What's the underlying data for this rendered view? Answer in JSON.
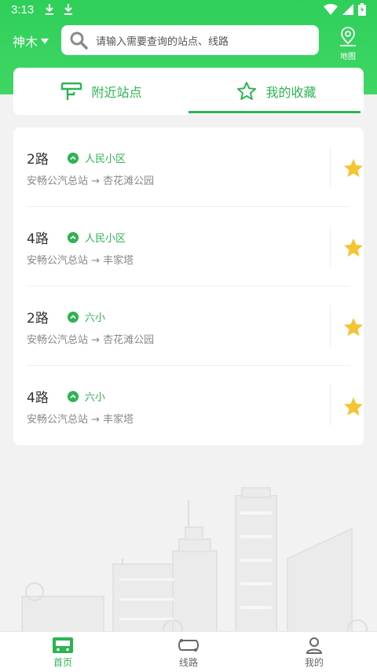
{
  "status_bar": {
    "time": "3:13"
  },
  "header": {
    "city": "神木",
    "search_placeholder": "请输入需要查询的站点、线路",
    "map_label": "地图"
  },
  "tabs": [
    {
      "label": "附近站点",
      "icon": "bus-stop-icon",
      "active": false
    },
    {
      "label": "我的收藏",
      "icon": "star-outline-icon",
      "active": true
    }
  ],
  "favorites": [
    {
      "route": "2路",
      "stop": "人民小区",
      "direction": "安畅公汽总站 → 杏花滩公园"
    },
    {
      "route": "4路",
      "stop": "人民小区",
      "direction": "安畅公汽总站 → 丰家塔"
    },
    {
      "route": "2路",
      "stop": "六小",
      "direction": "安畅公汽总站 → 杏花滩公园"
    },
    {
      "route": "4路",
      "stop": "六小",
      "direction": "安畅公汽总站 → 丰家塔"
    }
  ],
  "bottom_nav": [
    {
      "label": "首页",
      "icon": "bus-home-icon",
      "active": true
    },
    {
      "label": "线路",
      "icon": "route-icon",
      "active": false
    },
    {
      "label": "我的",
      "icon": "person-icon",
      "active": false
    }
  ],
  "colors": {
    "brand_green": "#2db452",
    "header_green": "#37d25e",
    "star": "#f5c431"
  }
}
